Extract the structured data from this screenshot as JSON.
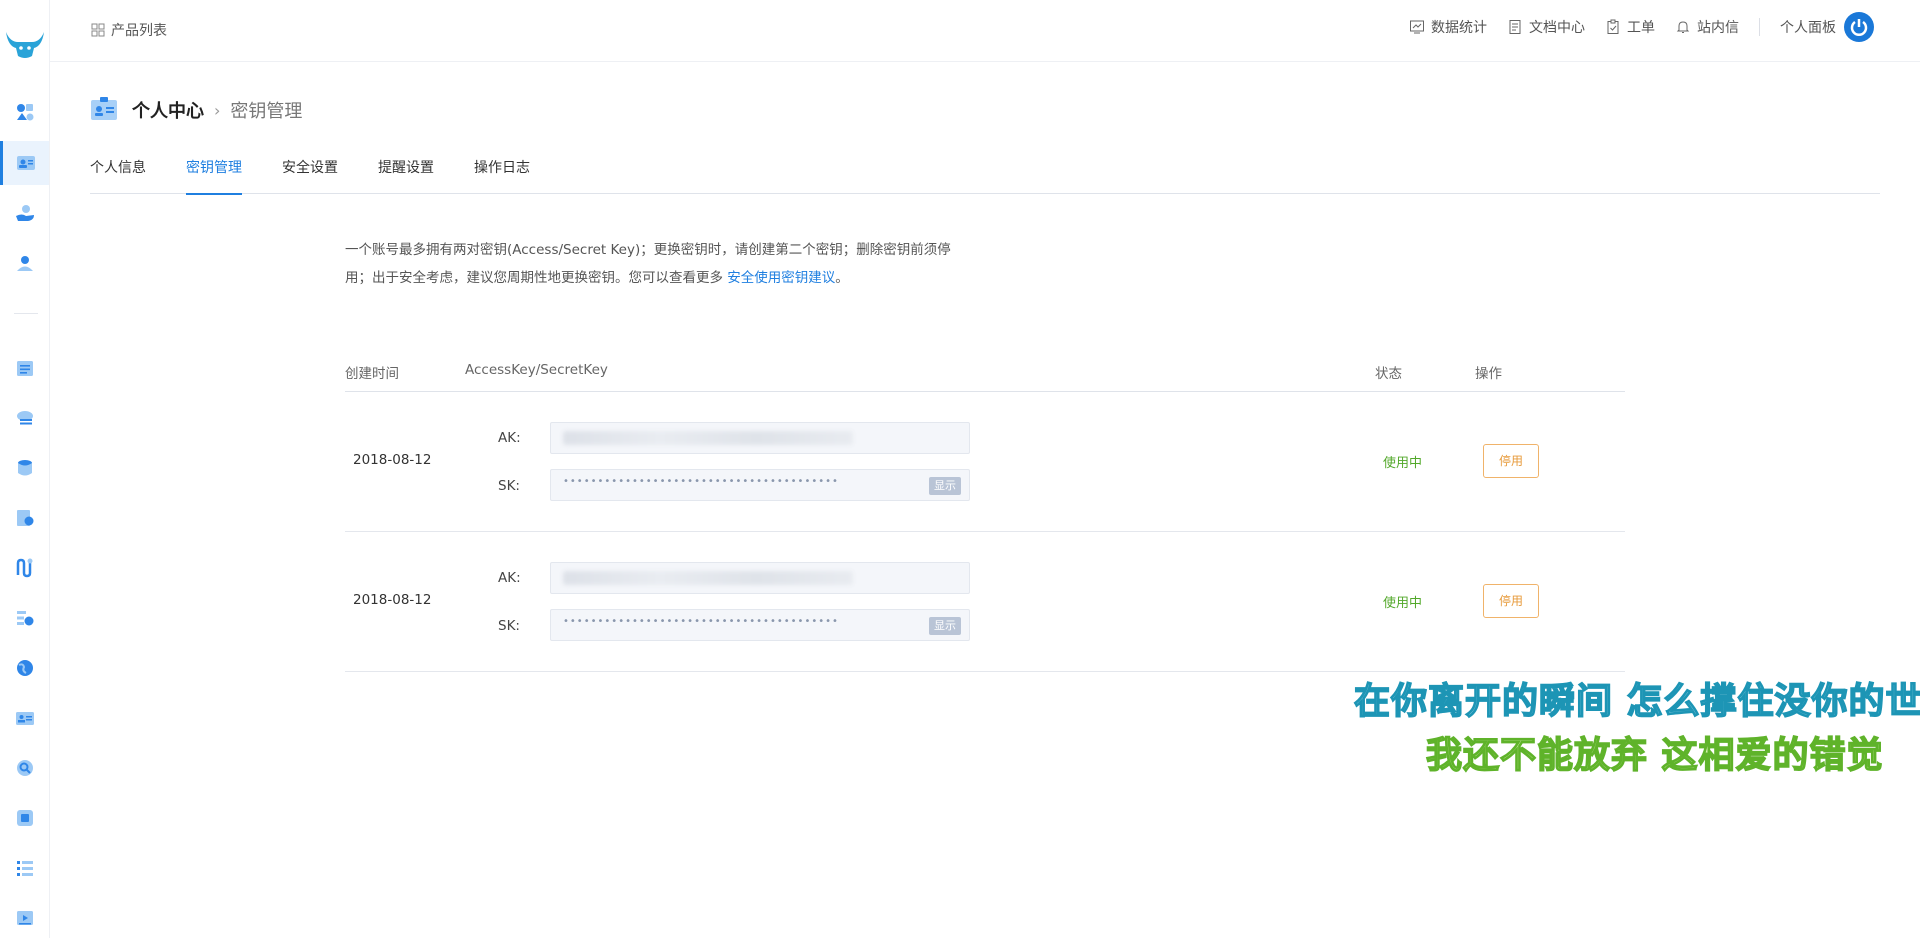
{
  "topbar": {
    "product_list": "产品列表",
    "links": [
      "数据统计",
      "文档中心",
      "工单",
      "站内信"
    ],
    "personal_panel": "个人面板"
  },
  "header": {
    "title": "个人中心",
    "subtitle": "密钥管理"
  },
  "tabs": [
    {
      "label": "个人信息",
      "active": false
    },
    {
      "label": "密钥管理",
      "active": true
    },
    {
      "label": "安全设置",
      "active": false
    },
    {
      "label": "提醒设置",
      "active": false
    },
    {
      "label": "操作日志",
      "active": false
    }
  ],
  "description": {
    "text1": "一个账号最多拥有两对密钥(Access/Secret Key)；更换密钥时，请创建第二个密钥；删除密钥前须停用；出于安全考虑，建议您周期性地更换密钥。您可以查看更多 ",
    "link": "安全使用密钥建议",
    "text2": "。"
  },
  "table": {
    "columns": [
      "创建时间",
      "AccessKey/SecretKey",
      "状态",
      "操作"
    ],
    "rows": [
      {
        "date": "2018-08-12",
        "ak_label": "AK:",
        "sk_label": "SK:",
        "sk_mask": "••••••••••••••••••••••••••••••••••••••••",
        "show_label": "显示",
        "status": "使用中",
        "action": "停用"
      },
      {
        "date": "2018-08-12",
        "ak_label": "AK:",
        "sk_label": "SK:",
        "sk_mask": "••••••••••••••••••••••••••••••••••••••••",
        "show_label": "显示",
        "status": "使用中",
        "action": "停用"
      }
    ]
  },
  "lyrics": {
    "line1": "在你离开的瞬间 怎么撑住没你的世界",
    "line2": "我还不能放弃 这相爱的错觉"
  },
  "colors": {
    "accent": "#1f7fe0",
    "status_green": "#52a82a",
    "warn_orange": "#e79a3a"
  }
}
